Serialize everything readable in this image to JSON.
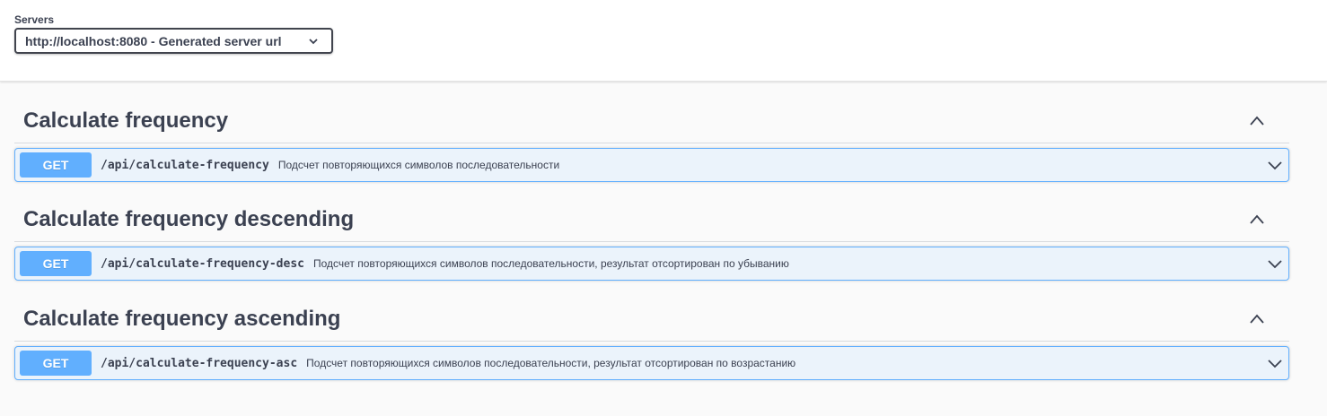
{
  "servers": {
    "label": "Servers",
    "selected": "http://localhost:8080 - Generated server url",
    "chevron_icon": "chevron-down-icon"
  },
  "tags": [
    {
      "title": "Calculate frequency",
      "toggle_icon": "chevron-up-icon",
      "operation": {
        "method": "GET",
        "path": "/api/calculate-frequency",
        "summary": "Подсчет повторяющихся символов последовательности"
      }
    },
    {
      "title": "Calculate frequency descending",
      "toggle_icon": "chevron-up-icon",
      "operation": {
        "method": "GET",
        "path": "/api/calculate-frequency-desc",
        "summary": "Подсчет повторяющихся символов последовательности, результат отсортирован по убыванию"
      }
    },
    {
      "title": "Calculate frequency ascending",
      "toggle_icon": "chevron-up-icon",
      "operation": {
        "method": "GET",
        "path": "/api/calculate-frequency-asc",
        "summary": "Подсчет повторяющихся символов последовательности, результат отсортирован по возрастанию"
      }
    }
  ],
  "colors": {
    "get_method": "#61affe",
    "get_background": "#ebf3fb",
    "text": "#3b4151"
  }
}
